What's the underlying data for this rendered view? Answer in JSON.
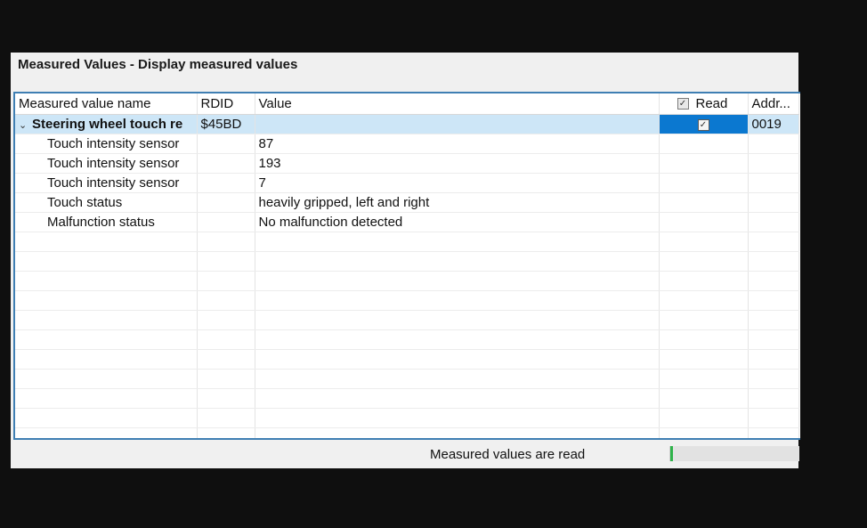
{
  "window": {
    "title": "Measured Values - Display measured values"
  },
  "table": {
    "headers": {
      "name": "Measured value name",
      "rdid": "RDID",
      "value": "Value",
      "read": "Read",
      "addr": "Addr..."
    },
    "group": {
      "name": "Steering wheel touch re",
      "rdid": "$45BD",
      "read_checked": true,
      "addr": "0019",
      "chevron_icon": "chevron-down-icon"
    },
    "rows": [
      {
        "name": "Touch intensity sensor",
        "value": "87"
      },
      {
        "name": "Touch intensity sensor",
        "value": "193"
      },
      {
        "name": "Touch intensity sensor",
        "value": "7"
      },
      {
        "name": "Touch status",
        "value": "heavily gripped, left and right"
      },
      {
        "name": "Malfunction status",
        "value": "No malfunction detected"
      }
    ]
  },
  "status": {
    "text": "Measured values are read",
    "progress_fraction": 0.02,
    "progress_color": "#2eb34a"
  },
  "colors": {
    "selection": "#0b78d0",
    "group_row": "#cde6f7",
    "frame": "#3f7fb3"
  }
}
